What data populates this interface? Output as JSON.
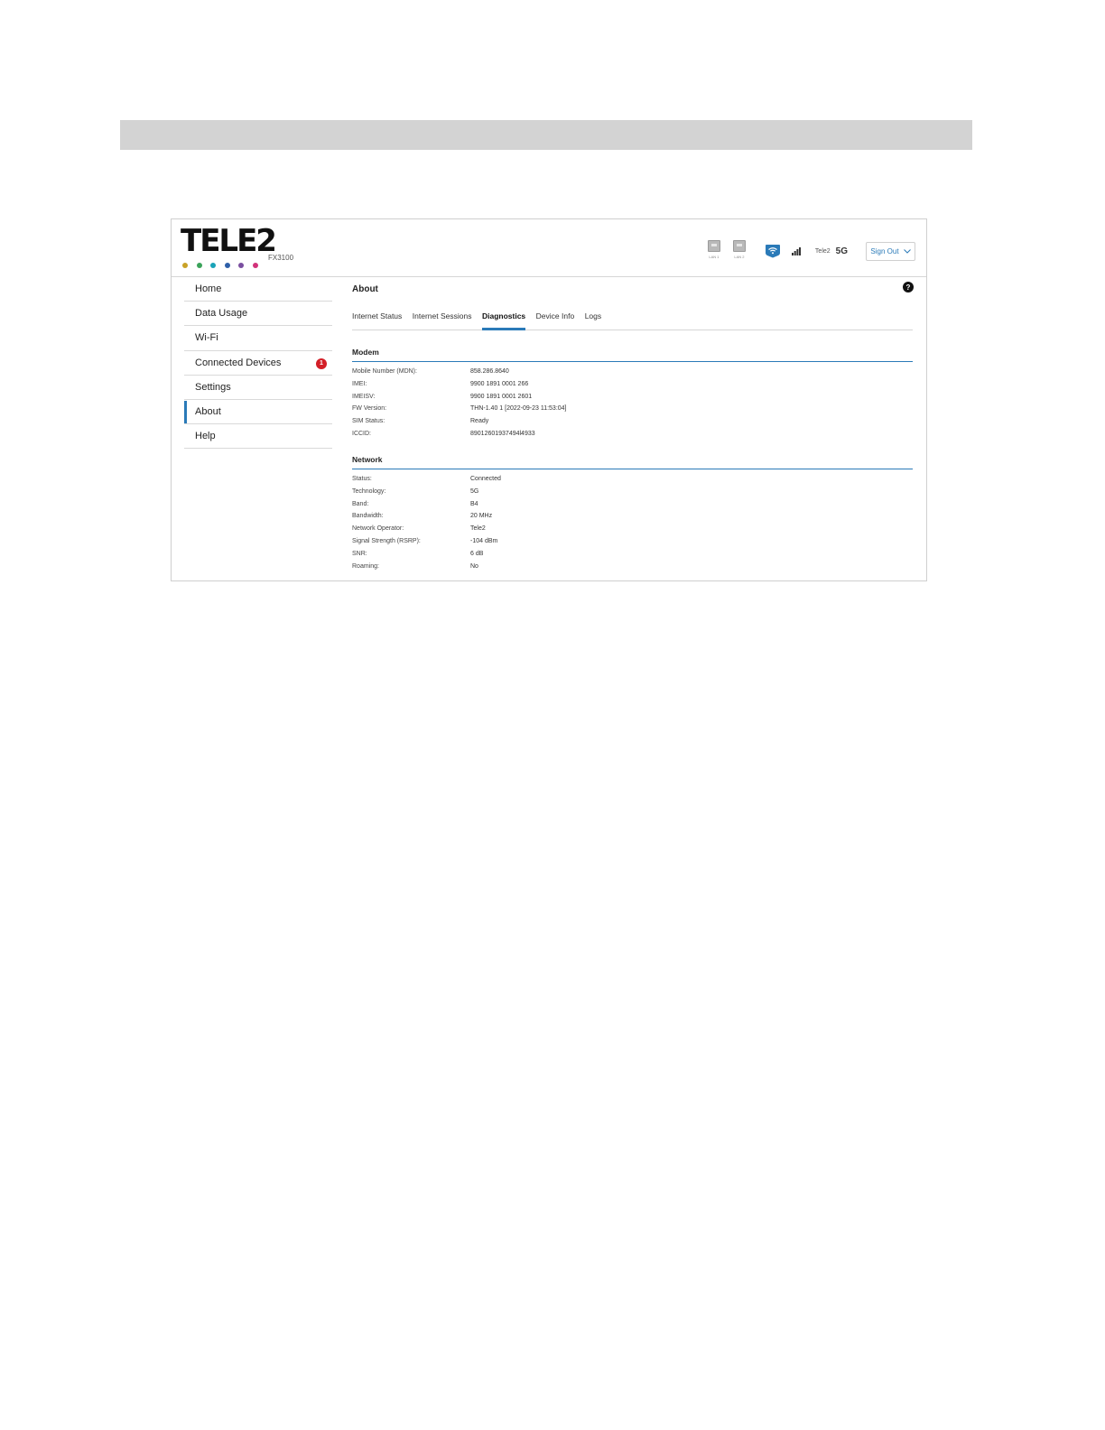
{
  "brand": {
    "logo_text": "TELE2",
    "model": "FX3100",
    "dot_colors": [
      "#c9a227",
      "#3ba35a",
      "#1aa3b8",
      "#2e5fa8",
      "#7a4fa0",
      "#d2327a"
    ]
  },
  "header": {
    "lan_ports": [
      {
        "icon": "ethernet-port-icon",
        "label": "LAN 1"
      },
      {
        "icon": "ethernet-port-icon",
        "label": "LAN 2"
      }
    ],
    "wifi_icon": "wifi-icon",
    "signal_icon": "signal-bars-icon",
    "operator": "Tele2",
    "network_type": "5G",
    "signout_label": "Sign Out"
  },
  "sidebar": {
    "items": [
      {
        "label": "Home",
        "active": false
      },
      {
        "label": "Data Usage",
        "active": false
      },
      {
        "label": "Wi-Fi",
        "active": false
      },
      {
        "label": "Connected Devices",
        "active": false,
        "badge": "1"
      },
      {
        "label": "Settings",
        "active": false
      },
      {
        "label": "About",
        "active": true
      },
      {
        "label": "Help",
        "active": false
      }
    ]
  },
  "main": {
    "title": "About",
    "help_label": "?",
    "tabs": [
      {
        "label": "Internet Status",
        "active": false
      },
      {
        "label": "Internet Sessions",
        "active": false
      },
      {
        "label": "Diagnostics",
        "active": true
      },
      {
        "label": "Device Info",
        "active": false
      },
      {
        "label": "Logs",
        "active": false
      }
    ],
    "modem": {
      "title": "Modem",
      "rows": [
        {
          "key": "Mobile Number (MDN):",
          "value": "858.286.8640"
        },
        {
          "key": "IMEI:",
          "value": "9900 1891 0001 266"
        },
        {
          "key": "IMEISV:",
          "value": "9900 1891 0001 2601"
        },
        {
          "key": "FW Version:",
          "value": "THN-1.40 1 [2022-09-23 11:53:04]"
        },
        {
          "key": "SIM Status:",
          "value": "Ready"
        },
        {
          "key": "ICCID:",
          "value": "89012601937494l4933"
        }
      ]
    },
    "network": {
      "title": "Network",
      "rows": [
        {
          "key": "Status:",
          "value": "Connected"
        },
        {
          "key": "Technology:",
          "value": "5G"
        },
        {
          "key": "Band:",
          "value": "B4"
        },
        {
          "key": "Bandwidth:",
          "value": "20 MHz"
        },
        {
          "key": "Network Operator:",
          "value": "Tele2"
        },
        {
          "key": "Signal Strength (RSRP):",
          "value": "-104 dBm"
        },
        {
          "key": "SNR:",
          "value": "6 dB"
        },
        {
          "key": "Roaming:",
          "value": "No"
        }
      ]
    }
  },
  "colors": {
    "accent": "#2a7ab8",
    "badge": "#d31f27",
    "top_bar": "#d3d3d3"
  }
}
